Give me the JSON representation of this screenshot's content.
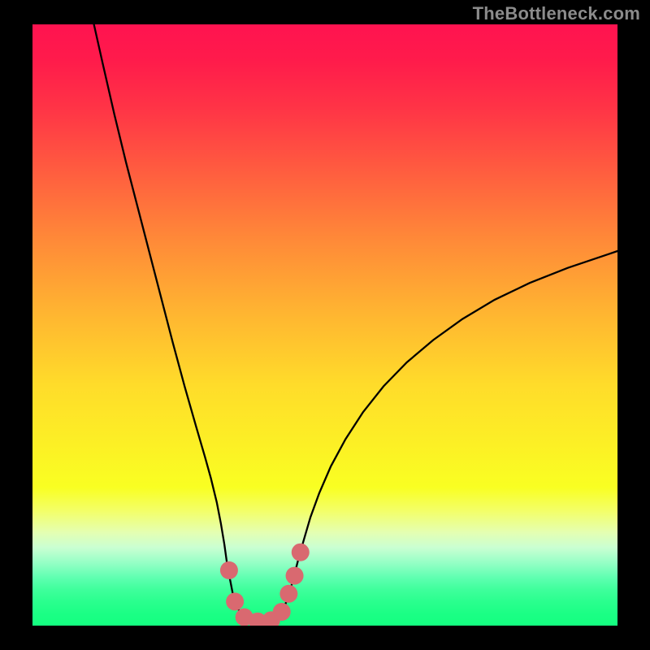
{
  "attribution": "TheBottleneck.com",
  "chart_data": {
    "type": "line",
    "title": "",
    "xlabel": "",
    "ylabel": "",
    "xlim": [
      0,
      100
    ],
    "ylim": [
      0,
      100
    ],
    "curve_main": {
      "name": "bottleneck-curve",
      "points": [
        {
          "x": 10.5,
          "y": 100.0
        },
        {
          "x": 12.0,
          "y": 93.5
        },
        {
          "x": 14.0,
          "y": 85.0
        },
        {
          "x": 16.0,
          "y": 77.0
        },
        {
          "x": 18.0,
          "y": 69.5
        },
        {
          "x": 20.0,
          "y": 62.0
        },
        {
          "x": 22.0,
          "y": 54.5
        },
        {
          "x": 24.0,
          "y": 47.0
        },
        {
          "x": 26.0,
          "y": 39.8
        },
        {
          "x": 28.0,
          "y": 33.0
        },
        {
          "x": 29.5,
          "y": 28.0
        },
        {
          "x": 30.5,
          "y": 24.5
        },
        {
          "x": 31.5,
          "y": 20.5
        },
        {
          "x": 32.2,
          "y": 17.0
        },
        {
          "x": 32.8,
          "y": 13.5
        },
        {
          "x": 33.3,
          "y": 10.0
        },
        {
          "x": 33.8,
          "y": 7.5
        },
        {
          "x": 34.3,
          "y": 5.0
        },
        {
          "x": 35.0,
          "y": 3.0
        },
        {
          "x": 36.0,
          "y": 1.5
        },
        {
          "x": 37.0,
          "y": 0.8
        },
        {
          "x": 38.0,
          "y": 0.5
        },
        {
          "x": 39.5,
          "y": 0.5
        },
        {
          "x": 41.0,
          "y": 0.8
        },
        {
          "x": 42.0,
          "y": 1.5
        },
        {
          "x": 43.0,
          "y": 3.0
        },
        {
          "x": 43.8,
          "y": 5.0
        },
        {
          "x": 44.5,
          "y": 7.5
        },
        {
          "x": 45.3,
          "y": 10.5
        },
        {
          "x": 46.3,
          "y": 14.0
        },
        {
          "x": 47.5,
          "y": 18.0
        },
        {
          "x": 49.0,
          "y": 22.0
        },
        {
          "x": 51.0,
          "y": 26.5
        },
        {
          "x": 53.5,
          "y": 31.0
        },
        {
          "x": 56.5,
          "y": 35.5
        },
        {
          "x": 60.0,
          "y": 39.8
        },
        {
          "x": 64.0,
          "y": 43.8
        },
        {
          "x": 68.5,
          "y": 47.5
        },
        {
          "x": 73.5,
          "y": 51.0
        },
        {
          "x": 79.0,
          "y": 54.2
        },
        {
          "x": 85.0,
          "y": 57.0
        },
        {
          "x": 91.5,
          "y": 59.5
        },
        {
          "x": 98.5,
          "y": 61.8
        },
        {
          "x": 100.0,
          "y": 62.3
        }
      ]
    },
    "markers": {
      "name": "highlighted-points",
      "color": "#d96970",
      "radius": 11,
      "points": [
        {
          "x": 33.6,
          "y": 9.2
        },
        {
          "x": 34.6,
          "y": 4.0
        },
        {
          "x": 36.2,
          "y": 1.4
        },
        {
          "x": 38.5,
          "y": 0.7
        },
        {
          "x": 40.8,
          "y": 0.9
        },
        {
          "x": 42.6,
          "y": 2.3
        },
        {
          "x": 43.8,
          "y": 5.3
        },
        {
          "x": 44.8,
          "y": 8.3
        },
        {
          "x": 45.8,
          "y": 12.2
        }
      ]
    },
    "gradient_stops": [
      {
        "pos": 0.0,
        "color": "#ff1350"
      },
      {
        "pos": 0.5,
        "color": "#ffb531"
      },
      {
        "pos": 0.77,
        "color": "#f9ff22"
      },
      {
        "pos": 1.0,
        "color": "#14ff80"
      }
    ]
  }
}
